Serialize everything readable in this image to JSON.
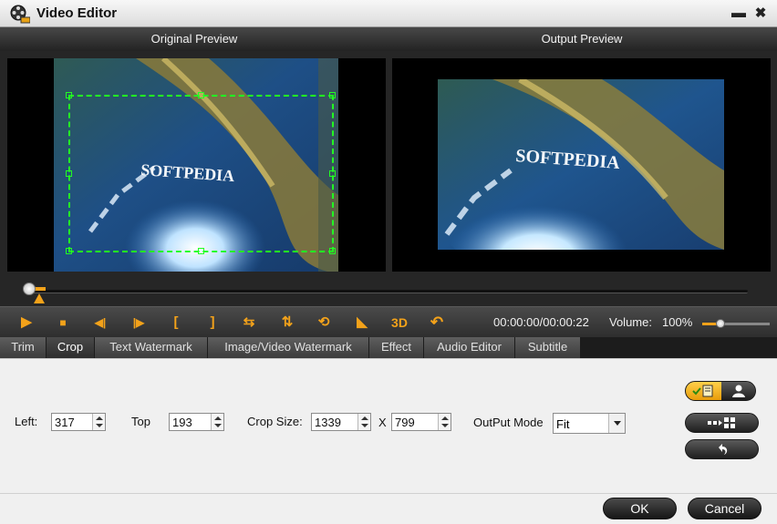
{
  "window": {
    "title": "Video Editor",
    "icon": "film-reel-icon",
    "minimize_glyph": "▬",
    "close_glyph": "✖"
  },
  "preview": {
    "original_label": "Original Preview",
    "output_label": "Output Preview",
    "video_text": "SOFTPEDIA"
  },
  "playback": {
    "position_fraction": 0.0,
    "time": "00:00:00/00:00:22",
    "volume_label": "Volume:",
    "volume_value": "100%",
    "buttons": [
      {
        "name": "play-icon",
        "glyph": "▶"
      },
      {
        "name": "stop-icon",
        "glyph": "■"
      },
      {
        "name": "prev-frame-icon",
        "glyph": "◀|"
      },
      {
        "name": "next-frame-icon",
        "glyph": "|▶"
      },
      {
        "name": "mark-in-icon",
        "glyph": "["
      },
      {
        "name": "mark-out-icon",
        "glyph": "]"
      },
      {
        "name": "flip-horizontal-icon",
        "glyph": "⇆"
      },
      {
        "name": "flip-vertical-icon",
        "glyph": "⇅"
      },
      {
        "name": "rotate-icon",
        "glyph": "⟲"
      },
      {
        "name": "snapshot-icon",
        "glyph": "◣"
      },
      {
        "name": "3d-label",
        "glyph": "3D"
      },
      {
        "name": "undo-icon",
        "glyph": "↶"
      }
    ]
  },
  "tabs": [
    {
      "label": "Trim",
      "active": false
    },
    {
      "label": "Crop",
      "active": true
    },
    {
      "label": "Text Watermark",
      "active": false
    },
    {
      "label": "Image/Video Watermark",
      "active": false
    },
    {
      "label": "Effect",
      "active": false
    },
    {
      "label": "Audio Editor",
      "active": false
    },
    {
      "label": "Subtitle",
      "active": false
    }
  ],
  "crop": {
    "left_label": "Left:",
    "left_value": "317",
    "top_label": "Top",
    "top_value": "193",
    "size_label": "Crop Size:",
    "width_value": "1339",
    "x_label": "X",
    "height_value": "799",
    "output_mode_label": "OutPut Mode",
    "output_mode_value": "Fit"
  },
  "footer": {
    "ok_label": "OK",
    "cancel_label": "Cancel"
  },
  "colors": {
    "accent": "#f3a21a",
    "crop_box": "#22ff22"
  }
}
